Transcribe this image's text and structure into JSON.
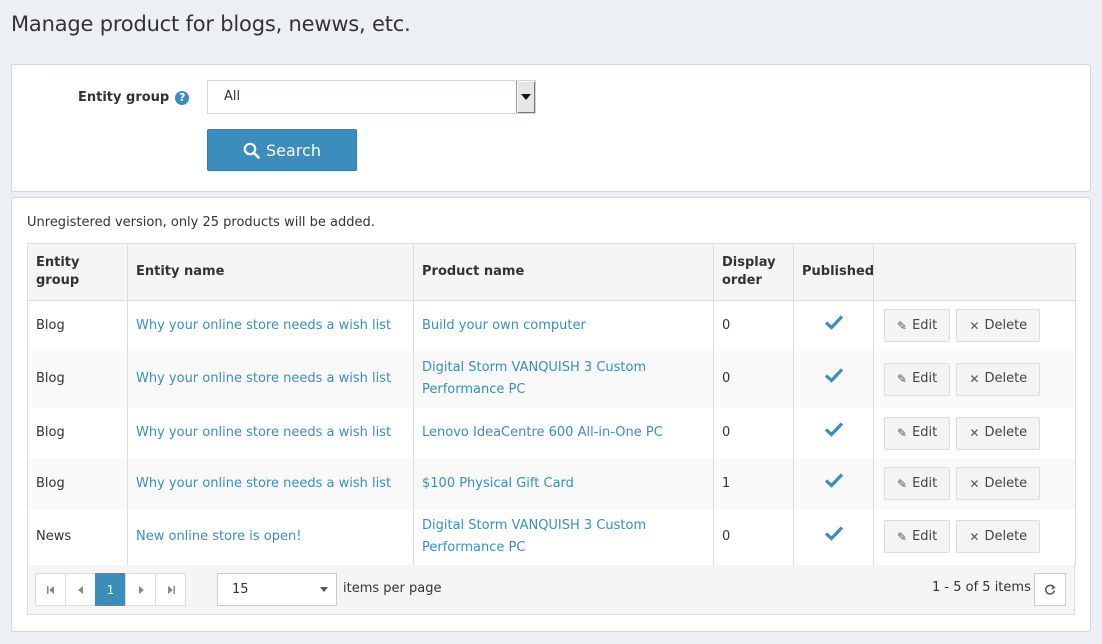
{
  "page": {
    "title": "Manage product for blogs, newws, etc."
  },
  "filter": {
    "entity_group_label": "Entity group",
    "help_glyph": "?",
    "entity_group_value": "All",
    "search_label": "Search"
  },
  "notice": "Unregistered version, only 25 products will be added.",
  "grid": {
    "columns": [
      "Entity group",
      "Entity name",
      "Product name",
      "Display order",
      "Published",
      ""
    ],
    "rows": [
      {
        "group": "Blog",
        "entity": "Why your online store needs a wish list",
        "product": "Build your own computer",
        "order": "0",
        "published": true
      },
      {
        "group": "Blog",
        "entity": "Why your online store needs a wish list",
        "product": "Digital Storm VANQUISH 3 Custom Performance PC",
        "order": "0",
        "published": true
      },
      {
        "group": "Blog",
        "entity": "Why your online store needs a wish list",
        "product": "Lenovo IdeaCentre 600 All-in-One PC",
        "order": "0",
        "published": true
      },
      {
        "group": "Blog",
        "entity": "Why your online store needs a wish list",
        "product": "$100 Physical Gift Card",
        "order": "1",
        "published": true
      },
      {
        "group": "News",
        "entity": "New online store is open!",
        "product": "Digital Storm VANQUISH 3 Custom Performance PC",
        "order": "0",
        "published": true
      }
    ],
    "edit_label": "Edit",
    "delete_label": "Delete",
    "edit_icon": "pencil-icon",
    "delete_icon": "close-icon",
    "check_color": "#3c8dbc"
  },
  "pager": {
    "current_page": "1",
    "page_size": "15",
    "per_page_label": "items per page",
    "range_text": "1 - 5 of 5 items"
  },
  "colors": {
    "accent": "#3c8dbc",
    "background": "#ecf0f5"
  }
}
